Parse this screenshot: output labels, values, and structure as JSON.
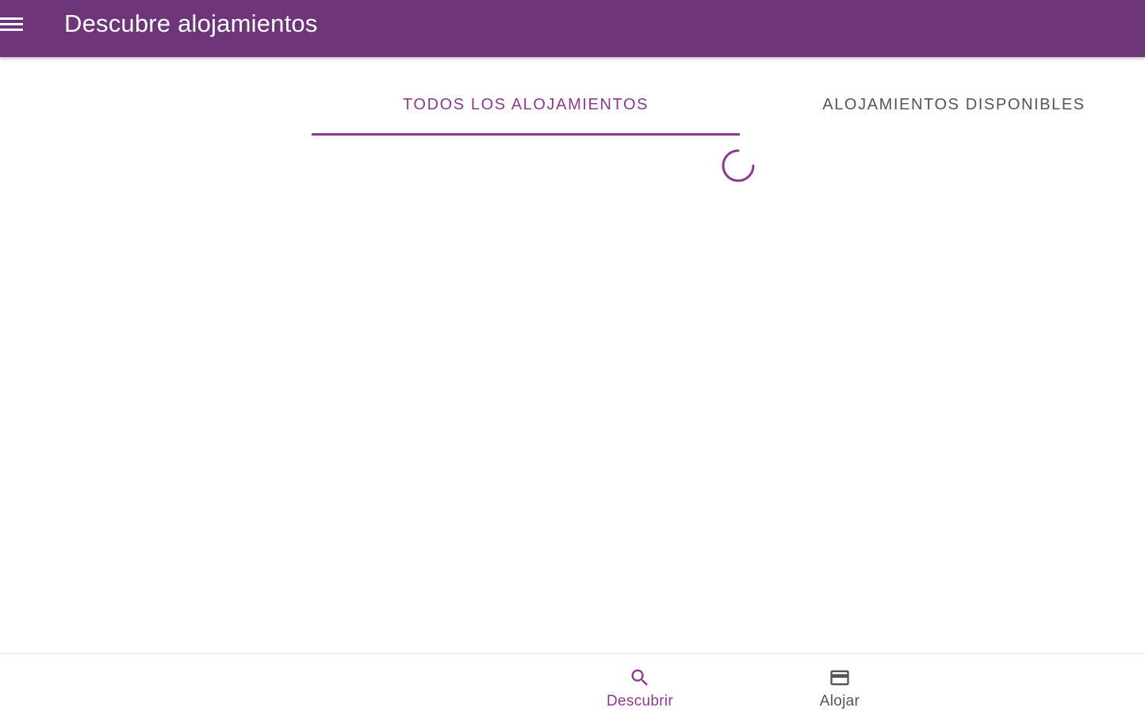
{
  "header": {
    "title": "Descubre alojamientos",
    "menu_icon": "menu-icon",
    "background_color": "#6e3679"
  },
  "tabs": [
    {
      "label": "TODOS LOS ALOJAMIENTOS",
      "selected": true
    },
    {
      "label": "ALOJAMIENTOS DISPONIBLES",
      "selected": false
    }
  ],
  "content": {
    "loading": true,
    "spinner_icon": "loading-spinner"
  },
  "bottom_nav": {
    "items": [
      {
        "label": "Descubrir",
        "icon": "search-icon",
        "active": true
      },
      {
        "label": "Alojar",
        "icon": "credit-card-icon",
        "active": false
      }
    ]
  },
  "colors": {
    "accent": "#8a3a8f",
    "inactive_text": "#555555"
  }
}
